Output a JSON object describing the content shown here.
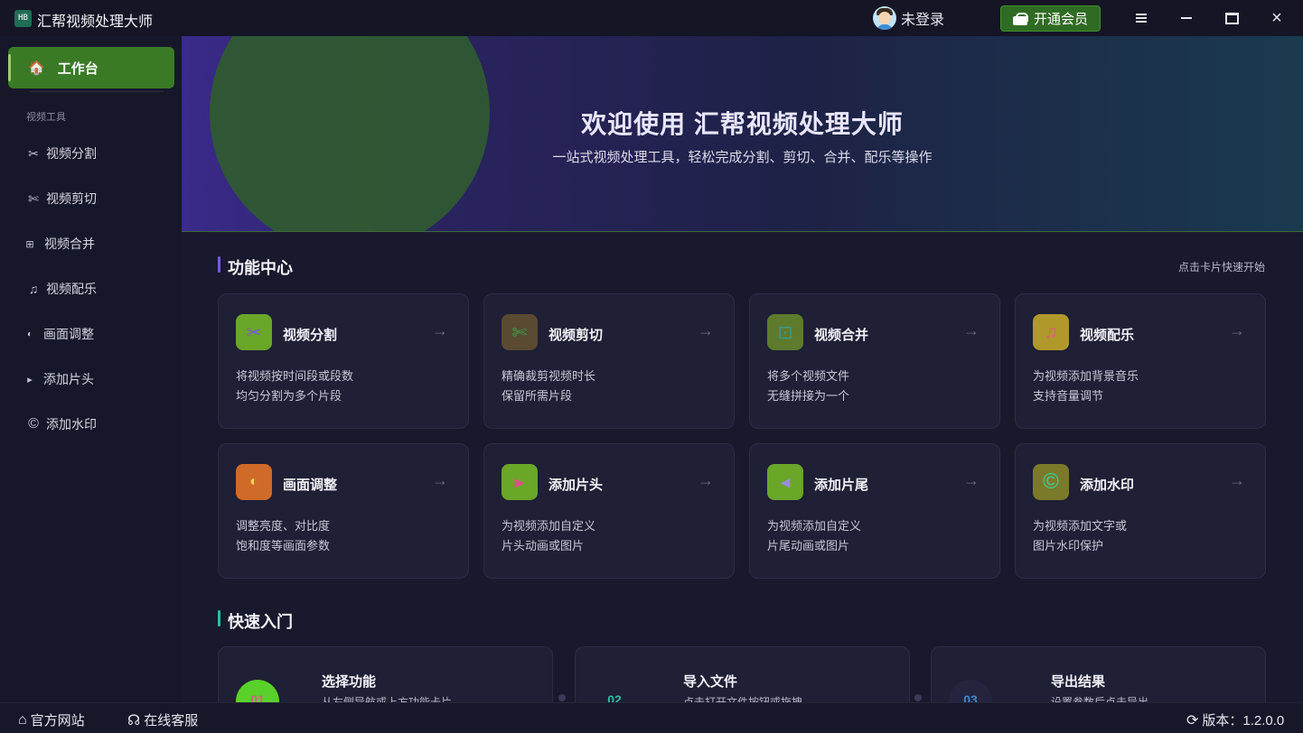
{
  "window": {
    "title": "汇帮视频处理大师",
    "logo_text": "HB"
  },
  "header": {
    "user_label": "未登录",
    "vip_button": "开通会员"
  },
  "sidebar": {
    "active_item": {
      "label": "工作台",
      "icon": "home-icon"
    },
    "section_label": "视频工具",
    "items": [
      {
        "label": "视频分割",
        "icon": "scissors-icon",
        "glyph": "✂"
      },
      {
        "label": "视频剪切",
        "icon": "cut-icon",
        "glyph": "✄"
      },
      {
        "label": "视频合并",
        "icon": "merge-icon",
        "glyph": "⊞"
      },
      {
        "label": "视频配乐",
        "icon": "music-icon",
        "glyph": "♫"
      },
      {
        "label": "画面调整",
        "icon": "contrast-icon",
        "glyph": "◐"
      },
      {
        "label": "添加片头",
        "icon": "play-icon",
        "glyph": "▸"
      },
      {
        "label": "添加水印",
        "icon": "copyright-icon",
        "glyph": "©"
      }
    ]
  },
  "hero": {
    "title": "欢迎使用 汇帮视频处理大师",
    "subtitle": "一站式视频处理工具，轻松完成分割、剪切、合并、配乐等操作"
  },
  "features": {
    "title": "功能中心",
    "hint": "点击卡片快速开始",
    "cards": [
      {
        "title": "视频分割",
        "desc1": "将视频按时间段或段数",
        "desc2": "均匀分割为多个片段",
        "icon": "scissors-icon",
        "glyph": "✂",
        "bg": "#6aa628",
        "fg": "#7a5ad8"
      },
      {
        "title": "视频剪切",
        "desc1": "精确裁剪视频时长",
        "desc2": "保留所需片段",
        "icon": "cut-icon",
        "glyph": "✄",
        "bg": "#5a4a32",
        "fg": "#3aa84a"
      },
      {
        "title": "视频合并",
        "desc1": "将多个视频文件",
        "desc2": "无缝拼接为一个",
        "icon": "merge-icon",
        "glyph": "⊡",
        "bg": "#5e7a2c",
        "fg": "#3a9a8a"
      },
      {
        "title": "视频配乐",
        "desc1": "为视频添加背景音乐",
        "desc2": "支持音量调节",
        "icon": "music-icon",
        "glyph": "♫",
        "bg": "#b0982a",
        "fg": "#e05a8a"
      },
      {
        "title": "画面调整",
        "desc1": "调整亮度、对比度",
        "desc2": "饱和度等画面参数",
        "icon": "contrast-icon",
        "glyph": "◐",
        "bg": "#d06a28",
        "fg": "#f2d25a"
      },
      {
        "title": "添加片头",
        "desc1": "为视频添加自定义",
        "desc2": "片头动画或图片",
        "icon": "play-icon",
        "glyph": "▶",
        "bg": "#6aa628",
        "fg": "#e0508a"
      },
      {
        "title": "添加片尾",
        "desc1": "为视频添加自定义",
        "desc2": "片尾动画或图片",
        "icon": "rewind-icon",
        "glyph": "◀",
        "bg": "#6aa628",
        "fg": "#9a8ae0"
      },
      {
        "title": "添加水印",
        "desc1": "为视频添加文字或",
        "desc2": "图片水印保护",
        "icon": "copyright-icon",
        "glyph": "©",
        "bg": "#7a7a2a",
        "fg": "#3ad0a0"
      }
    ],
    "arrow": "→"
  },
  "quickstart": {
    "title": "快速入门",
    "steps": [
      {
        "num": "01",
        "title": "选择功能",
        "desc": "从左侧导航或上方功能卡片",
        "bg": "#5ad02a",
        "fg": "#e05a8a"
      },
      {
        "num": "02",
        "title": "导入文件",
        "desc": "点击打开文件按钮或拖拽",
        "bg": "#1f1f35",
        "fg": "#2ac0a0"
      },
      {
        "num": "03",
        "title": "导出结果",
        "desc": "设置参数后点击导出",
        "bg": "#24243e",
        "fg": "#3a8ad0"
      }
    ]
  },
  "footer": {
    "website": "官方网站",
    "support": "在线客服",
    "version": "版本：1.2.0.0"
  },
  "colors": {
    "accent_green": "#3a7a26",
    "hero_start": "#3a2a8a",
    "hero_end": "#1a3a4e",
    "section_bar_features": "#7a5ad8",
    "section_bar_quickstart": "#2ac0a0"
  }
}
